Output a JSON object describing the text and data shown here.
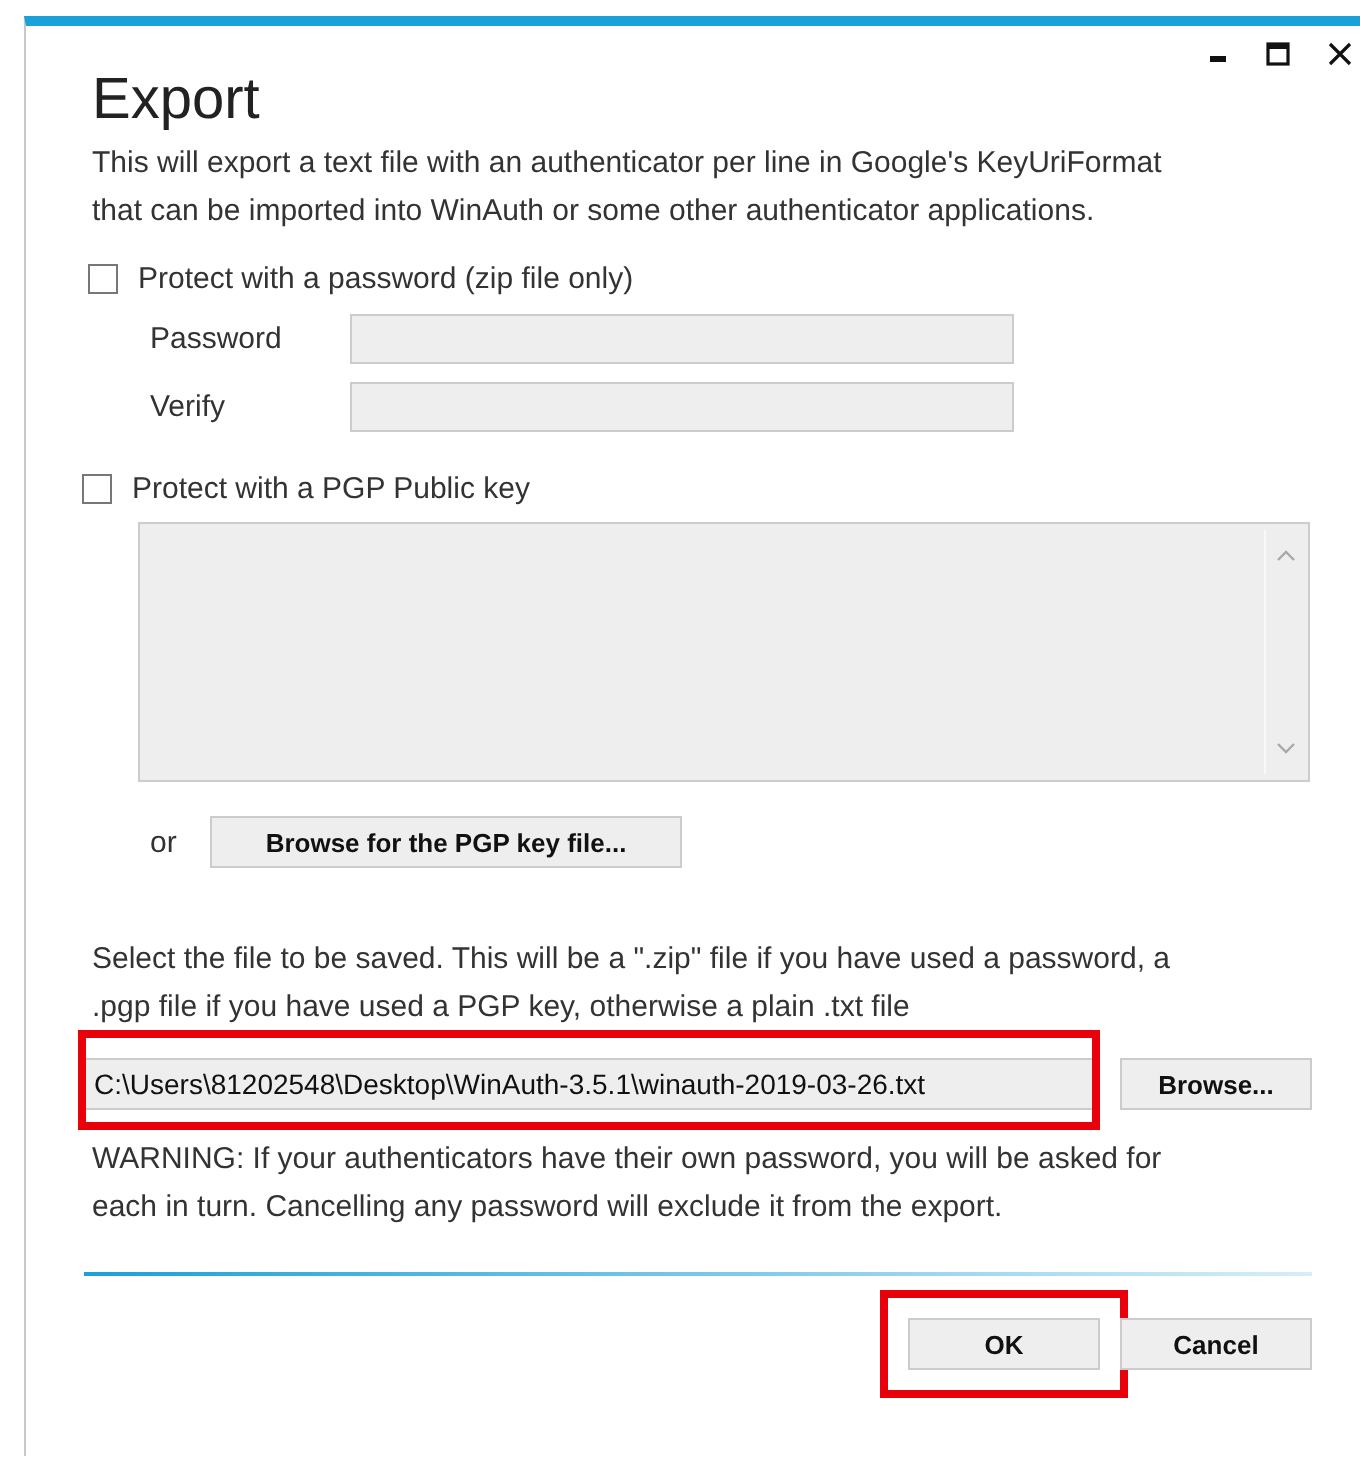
{
  "window": {
    "title": "Export"
  },
  "description": "This will export a text file with an authenticator per line in Google's KeyUriFormat that can be imported into WinAuth or some other authenticator applications.",
  "password_protect": {
    "label": "Protect with a password (zip file only)",
    "checked": false,
    "fields": [
      {
        "label": "Password",
        "disabled": true
      },
      {
        "label": "Verify",
        "disabled": true
      }
    ]
  },
  "pgp_protect": {
    "label": "Protect with a PGP Public key",
    "checked": false,
    "key_box": {
      "disabled": true
    },
    "or_label": "or",
    "browse_button": "Browse for the PGP key file..."
  },
  "file_hint": "Select the file to be saved. This will be a \".zip\" file if you have used a password, a .pgp file if you have used a PGP key, otherwise a plain .txt file",
  "file_path": {
    "value": "C:\\Users\\81202548\\Desktop\\WinAuth-3.5.1\\winauth-2019-03-26.txt",
    "highlighted": true
  },
  "browse_button": "Browse...",
  "warning": "WARNING: If your authenticators have their own password, you will be asked for each in turn. Cancelling any password will exclude it from the export.",
  "buttons": [
    {
      "label": "OK",
      "highlighted": true
    },
    {
      "label": "Cancel",
      "highlighted": false
    }
  ]
}
